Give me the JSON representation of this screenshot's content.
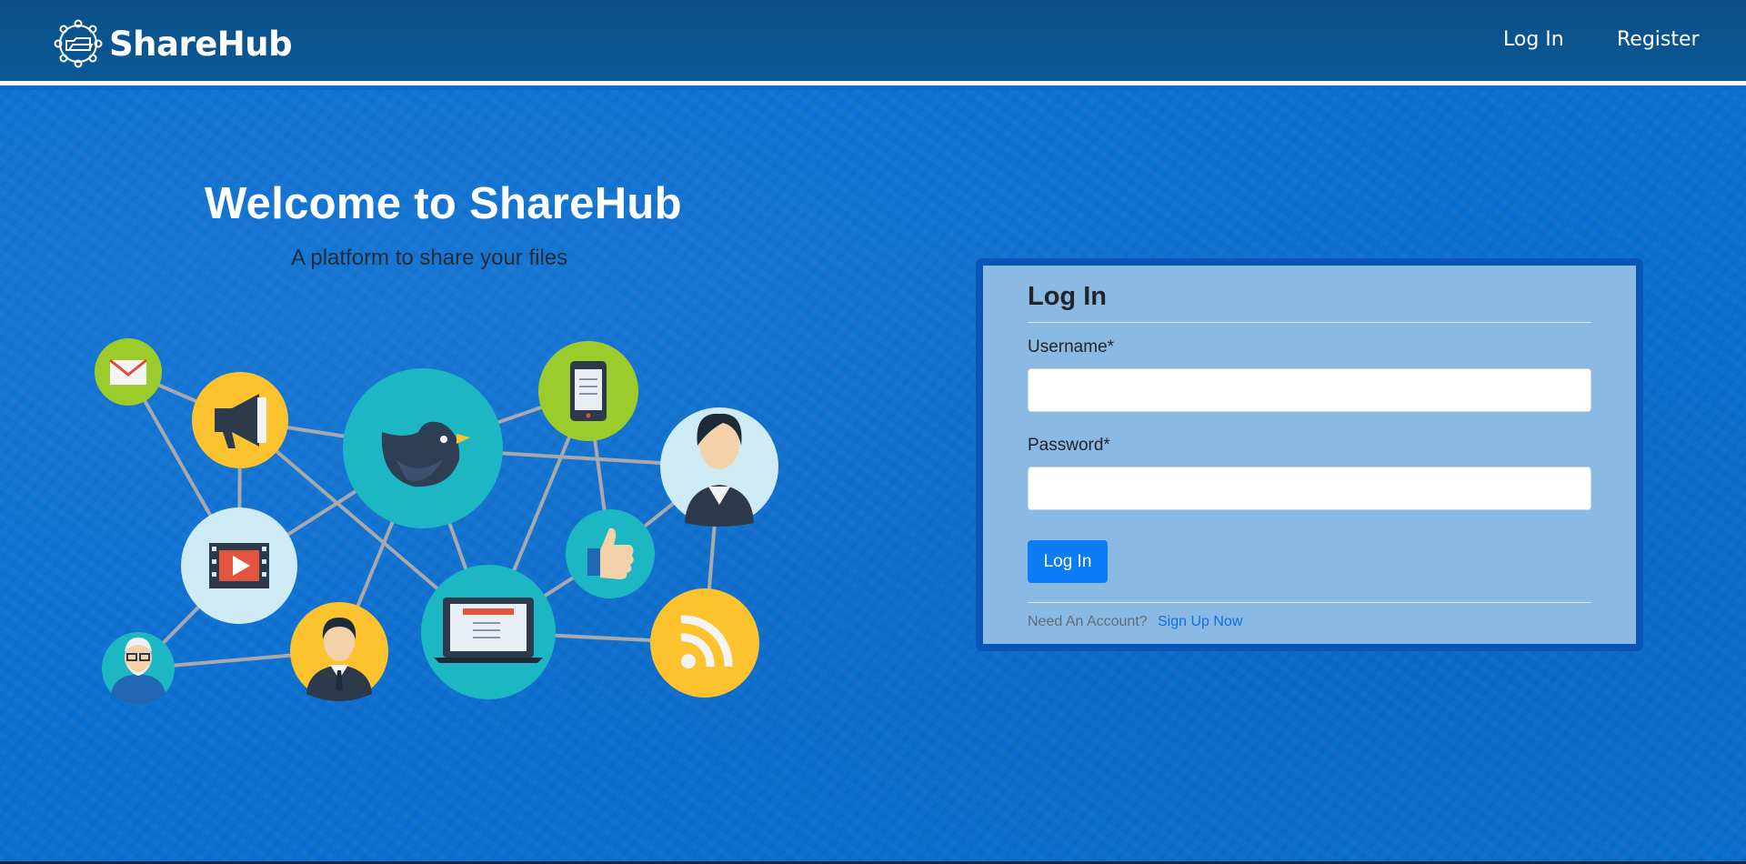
{
  "header": {
    "brand_name": "ShareHub",
    "nav": {
      "login": "Log In",
      "register": "Register"
    }
  },
  "hero": {
    "title": "Welcome to ShareHub",
    "subtitle": "A platform to share your files",
    "illustration_icons": [
      "mail-icon",
      "megaphone-icon",
      "bird-icon",
      "phone-icon",
      "businesswoman-icon",
      "video-icon",
      "thumbs-up-icon",
      "laptop-icon",
      "rss-icon",
      "old-man-icon",
      "businessman-icon"
    ]
  },
  "login_form": {
    "title": "Log In",
    "username_label": "Username*",
    "username_value": "",
    "password_label": "Password*",
    "password_value": "",
    "submit_label": "Log In",
    "footer_text": "Need An Account?",
    "signup_link": "Sign Up Now"
  },
  "colors": {
    "header_bg": "#0a548f",
    "page_bg": "#0b70d2",
    "card_bg": "#8ab9e4",
    "card_border": "#0a56b8",
    "primary_button": "#0d7bf5",
    "yellow_circle": "#fdc32e",
    "teal_circle": "#1db7c4",
    "green_circle": "#9ccb2c",
    "light_circle": "#cdeaf5"
  }
}
